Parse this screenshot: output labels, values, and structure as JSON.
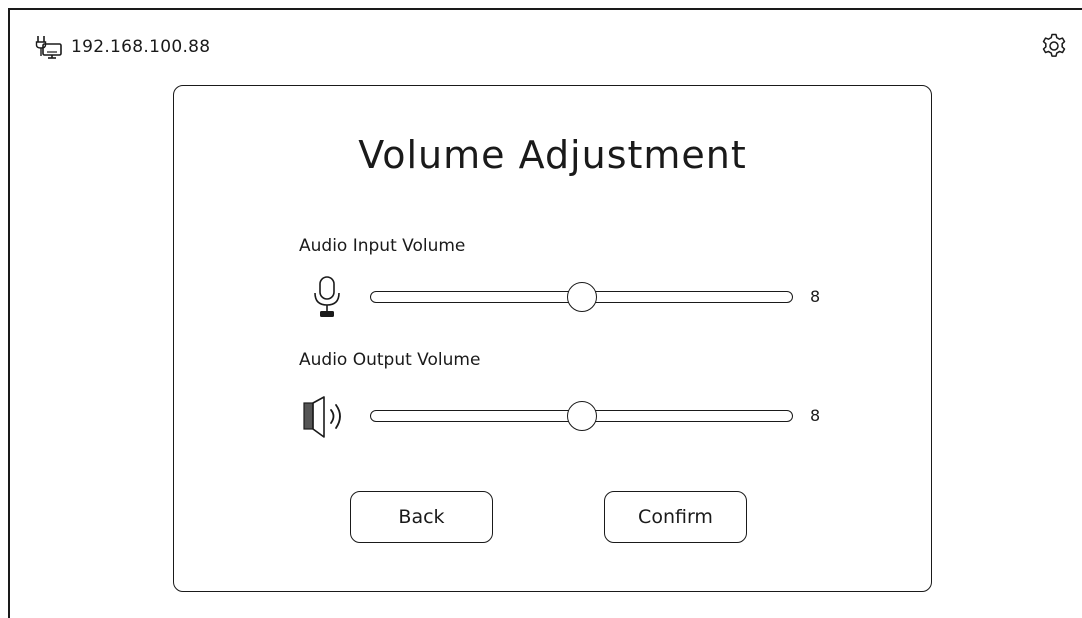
{
  "header": {
    "ip_address": "192.168.100.88",
    "network_icon": "network-monitor-icon",
    "settings_icon": "gear-icon"
  },
  "dialog": {
    "title": "Volume Adjustment",
    "input_volume": {
      "label": "Audio Input Volume",
      "icon": "microphone-icon",
      "value": "8",
      "slider_fraction": 0.5
    },
    "output_volume": {
      "label": "Audio Output Volume",
      "icon": "speaker-icon",
      "value": "8",
      "slider_fraction": 0.5
    },
    "back_label": "Back",
    "confirm_label": "Confirm"
  },
  "colors": {
    "stroke": "#1a1a1a",
    "background": "#ffffff"
  }
}
